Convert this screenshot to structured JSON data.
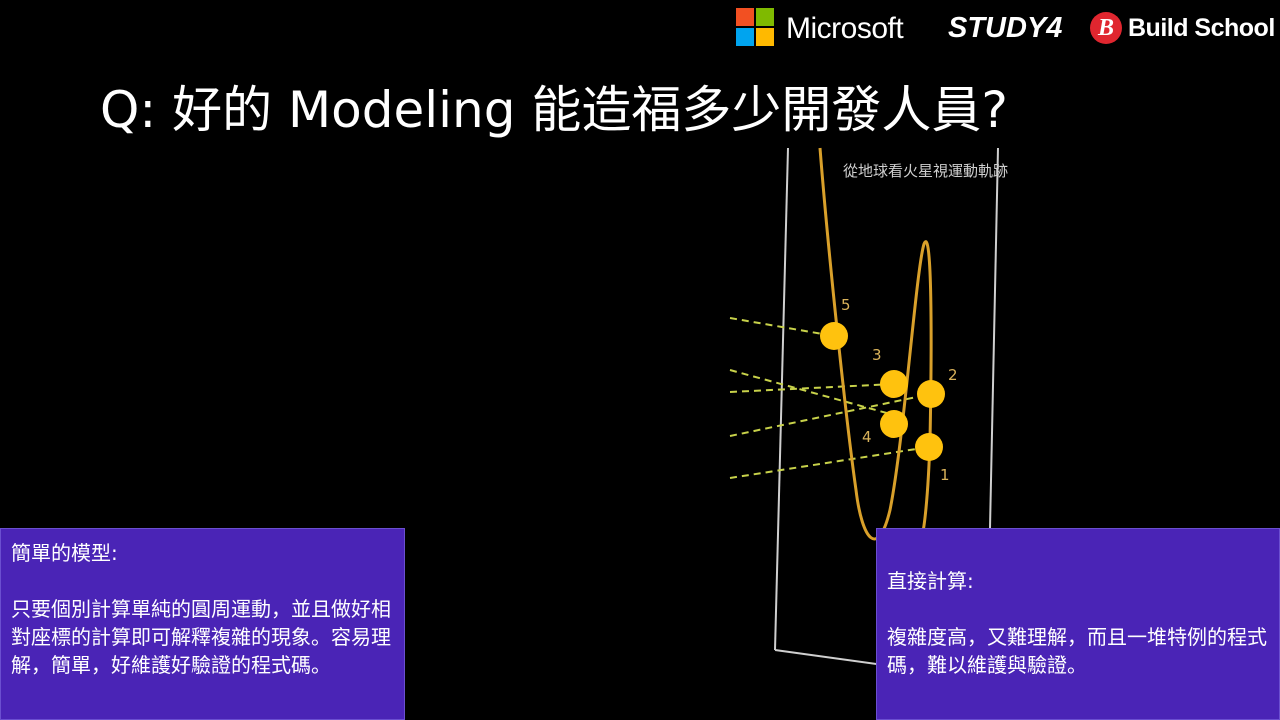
{
  "header": {
    "logos": {
      "microsoft": "Microsoft",
      "study4": "STUDY4",
      "build_school_mark": "B",
      "build_school": "Build School"
    },
    "microsoft_colors": [
      "#f25022",
      "#7fba00",
      "#00a4ef",
      "#ffb900"
    ]
  },
  "slide": {
    "title": "Q: 好的 Modeling 能造福多少開發人員?"
  },
  "figure": {
    "caption": "從地球看火星視運動軌跡",
    "point_labels": [
      "5",
      "3",
      "2",
      "4",
      "1"
    ],
    "colors": {
      "orbit": "#d9a02a",
      "planet": "#ffc20e",
      "sight_line": "#c8d24a",
      "frame": "#cfcfcf"
    }
  },
  "left_box": {
    "heading": "簡單的模型:",
    "body": "只要個別計算單純的圓周運動，並且做好相對座標的計算即可解釋複雜的現象。容易理解，簡單，好維護好驗證的程式碼。"
  },
  "right_box": {
    "heading": "直接計算:",
    "body": "複雜度高，又難理解，而且一堆特例的程式碼，難以維護與驗證。"
  },
  "theme": {
    "background": "#000000",
    "box_bg": "#4a24b6",
    "text": "#ffffff"
  }
}
